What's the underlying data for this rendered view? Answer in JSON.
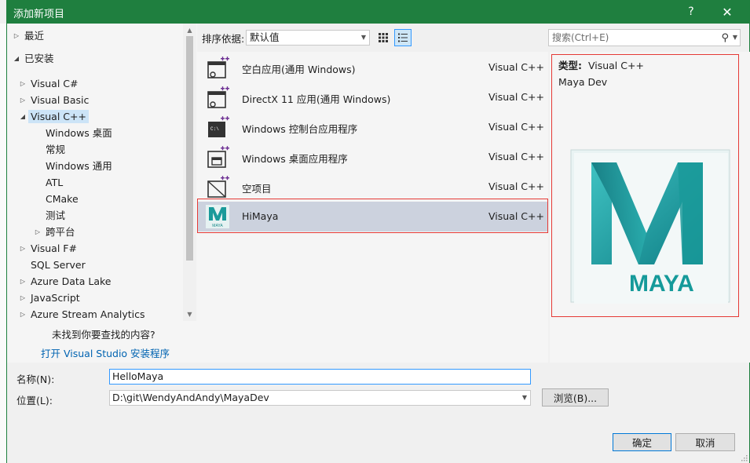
{
  "window": {
    "title": "添加新项目",
    "help": "?",
    "close": "✕"
  },
  "tree": {
    "items": [
      {
        "label": "最近",
        "level": 0,
        "expander": "▷"
      },
      {
        "label": "已安装",
        "level": 0,
        "expander": "◢"
      },
      {
        "label": "Visual C#",
        "level": 1,
        "expander": "▷"
      },
      {
        "label": "Visual Basic",
        "level": 1,
        "expander": "▷"
      },
      {
        "label": "Visual C++",
        "level": 1,
        "expander": "◢",
        "selected": true
      },
      {
        "label": "Windows 桌面",
        "level": 2,
        "expander": ""
      },
      {
        "label": "常规",
        "level": 2,
        "expander": ""
      },
      {
        "label": "Windows 通用",
        "level": 2,
        "expander": ""
      },
      {
        "label": "ATL",
        "level": 2,
        "expander": ""
      },
      {
        "label": "CMake",
        "level": 2,
        "expander": ""
      },
      {
        "label": "测试",
        "level": 2,
        "expander": ""
      },
      {
        "label": "跨平台",
        "level": 2,
        "expander": "▷"
      },
      {
        "label": "Visual F#",
        "level": 1,
        "expander": "▷"
      },
      {
        "label": "SQL Server",
        "level": 1,
        "expander": ""
      },
      {
        "label": "Azure Data Lake",
        "level": 1,
        "expander": "▷"
      },
      {
        "label": "JavaScript",
        "level": 1,
        "expander": "▷"
      },
      {
        "label": "Azure Stream Analytics",
        "level": 1,
        "expander": "▷"
      }
    ],
    "not_found": "未找到你要查找的内容?",
    "install_link": "打开 Visual Studio 安装程序"
  },
  "toolbar": {
    "sort_label": "排序依据:",
    "sort_value": "默认值",
    "search_placeholder": "搜索(Ctrl+E)"
  },
  "templates": [
    {
      "name": "空白应用(通用 Windows)",
      "lang": "Visual C++",
      "icon": "blank-app-icon"
    },
    {
      "name": "DirectX 11 应用(通用 Windows)",
      "lang": "Visual C++",
      "icon": "directx-app-icon"
    },
    {
      "name": "Windows 控制台应用程序",
      "lang": "Visual C++",
      "icon": "console-app-icon"
    },
    {
      "name": "Windows 桌面应用程序",
      "lang": "Visual C++",
      "icon": "desktop-app-icon"
    },
    {
      "name": "空项目",
      "lang": "Visual C++",
      "icon": "empty-project-icon"
    },
    {
      "name": "HiMaya",
      "lang": "Visual C++",
      "icon": "maya-icon",
      "selected": true
    }
  ],
  "details": {
    "type_label": "类型:",
    "type_value": "Visual C++",
    "description": "Maya Dev",
    "logo_text": "MAYA",
    "icon_caption": "MAYA"
  },
  "form": {
    "name_label": "名称(N):",
    "name_value": "HelloMaya",
    "location_label": "位置(L):",
    "location_value": "D:\\git\\WendyAndAndy\\MayaDev",
    "browse_label": "浏览(B)...",
    "ok_label": "确定",
    "cancel_label": "取消"
  },
  "colors": {
    "titlebar": "#1f7f3f",
    "accent": "#0078d7",
    "highlight_outline": "#e53935",
    "maya_teal": "#1a9a9a"
  }
}
